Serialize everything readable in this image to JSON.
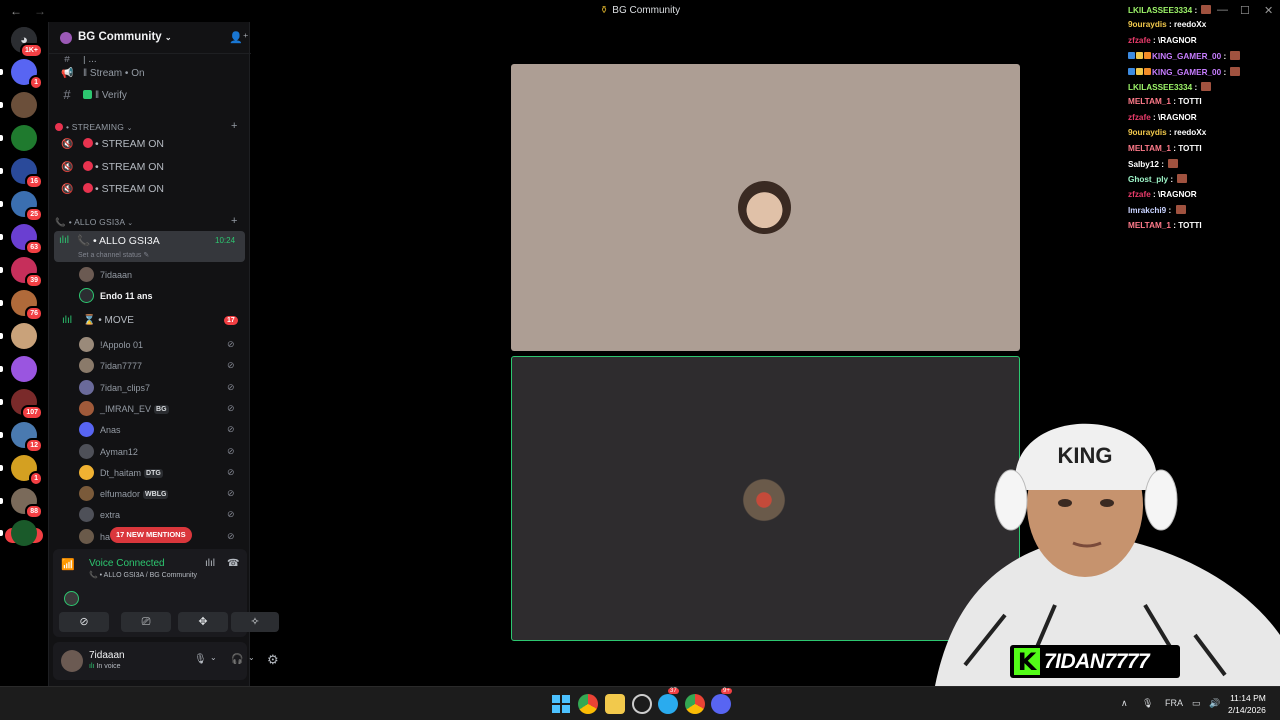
{
  "window": {
    "title": "BG Community"
  },
  "server_rail": {
    "home_badge": "1K+",
    "items": [
      {
        "color": "#5865f2",
        "badge": "1"
      },
      {
        "color": "#6b4f3a",
        "badge": ""
      },
      {
        "color": "#1f7a2e",
        "badge": ""
      },
      {
        "color": "#2a4a9a",
        "badge": "16"
      },
      {
        "color": "#3b6fb0",
        "badge": "25"
      },
      {
        "color": "#6a3fd1",
        "badge": "63"
      },
      {
        "color": "#c62f5b",
        "badge": "39"
      },
      {
        "color": "#b06a3a",
        "badge": "76"
      },
      {
        "color": "#c9a27a",
        "badge": ""
      },
      {
        "color": "#9a55e0",
        "badge": ""
      },
      {
        "color": "#7a2a2a",
        "badge": "107"
      },
      {
        "color": "#4a7ab0",
        "badge": "12"
      },
      {
        "color": "#d4a021",
        "badge": "1"
      },
      {
        "color": "#7a6a5a",
        "badge": "88"
      },
      {
        "color": "#1a5a2a",
        "badge": ""
      }
    ],
    "new_label": "NEW"
  },
  "guild": {
    "name": "BG Community"
  },
  "channels": {
    "partial_top": "| ...",
    "text": [
      {
        "icon": "speaker-icon",
        "label": "‖ Stream • On"
      },
      {
        "icon": "hash-icon",
        "label": "‖ Verify"
      }
    ],
    "cat_streaming": "• STREAMING",
    "streaming": [
      "• STREAM ON",
      "• STREAM ON",
      "• STREAM ON"
    ],
    "cat_allo": "• ALLO GSI3A",
    "active_channel": "• ALLO GSI3A",
    "active_time": "10:24",
    "set_status": "Set a channel status",
    "allo_users": [
      {
        "name": "7idaaan",
        "bright": false
      },
      {
        "name": "Endo 11 ans",
        "bright": true
      }
    ],
    "move_channel": "• MOVE",
    "move_badge": "17",
    "move_users": [
      {
        "name": "!Appolo 01",
        "tag": "",
        "color": "#9a8a7a"
      },
      {
        "name": "7idan7777",
        "tag": "",
        "color": "#8a7a6a"
      },
      {
        "name": "7idan_clips7",
        "tag": "",
        "color": "#6a6a9a"
      },
      {
        "name": "_IMRAN_EV",
        "tag": "BG",
        "color": "#a05a3a"
      },
      {
        "name": "Anas",
        "tag": "",
        "color": "#5865f2"
      },
      {
        "name": "Ayman12",
        "tag": "",
        "color": "#4e5058"
      },
      {
        "name": "Dt_haitam",
        "tag": "DTG",
        "color": "#f0b232"
      },
      {
        "name": "elfumador",
        "tag": "WBLG",
        "color": "#7a5a3a"
      },
      {
        "name": "extra",
        "tag": "",
        "color": "#4e5058"
      },
      {
        "name": "ha",
        "tag": "",
        "color": "#6a5a4a"
      }
    ],
    "new_mentions": "17 NEW MENTIONS"
  },
  "voice": {
    "status": "Voice Connected",
    "channel": "• ALLO GSI3A / BG Community"
  },
  "user": {
    "name": "7idaaan",
    "status": "In voice"
  },
  "chat": [
    {
      "user": "LKILASSEE3334",
      "color": "#9ef56a",
      "text": "",
      "emote": true,
      "badges": false
    },
    {
      "user": "9ouraydis",
      "color": "#f2c94c",
      "text": "reedoXx",
      "emote": false,
      "badges": false
    },
    {
      "user": "zfzafe",
      "color": "#e83b6a",
      "text": "\\RAGNOR",
      "emote": false,
      "badges": false
    },
    {
      "user": "KING_GAMER_00",
      "color": "#c77dff",
      "text": "",
      "emote": true,
      "badges": true
    },
    {
      "user": "KING_GAMER_00",
      "color": "#c77dff",
      "text": "",
      "emote": true,
      "badges": true
    },
    {
      "user": "LKILASSEE3334",
      "color": "#9ef56a",
      "text": "",
      "emote": true,
      "badges": false
    },
    {
      "user": "MELTAM_1",
      "color": "#ff7a8a",
      "text": "TOTTI",
      "emote": false,
      "badges": false
    },
    {
      "user": "zfzafe",
      "color": "#e83b6a",
      "text": "\\RAGNOR",
      "emote": false,
      "badges": false
    },
    {
      "user": "9ouraydis",
      "color": "#f2c94c",
      "text": "reedoXx",
      "emote": false,
      "badges": false
    },
    {
      "user": "MELTAM_1",
      "color": "#ff7a8a",
      "text": "TOTTI",
      "emote": false,
      "badges": false
    },
    {
      "user": "Salby12",
      "color": "#ffffff",
      "text": "",
      "emote": true,
      "badges": false
    },
    {
      "user": "Ghost_ply",
      "color": "#9ef5c8",
      "text": "",
      "emote": true,
      "badges": false
    },
    {
      "user": "zfzafe",
      "color": "#e83b6a",
      "text": "\\RAGNOR",
      "emote": false,
      "badges": false
    },
    {
      "user": "Imrakchi9",
      "color": "#c8d2ff",
      "text": "",
      "emote": true,
      "badges": false
    },
    {
      "user": "MELTAM_1",
      "color": "#ff7a8a",
      "text": "TOTTI",
      "emote": false,
      "badges": false
    }
  ],
  "webcam": {
    "channel_name": "7IDAN7777",
    "logo_letter": "K",
    "cap_text": "KING"
  },
  "taskbar": {
    "telegram_badge": "37",
    "discord_badge": "9+",
    "lang": "FRA",
    "time": "11:14 PM",
    "date": "2/14/2026"
  },
  "colors": {
    "accent_green": "#2dc770",
    "mention_red": "#f23f43",
    "kick_green": "#53fc18"
  }
}
